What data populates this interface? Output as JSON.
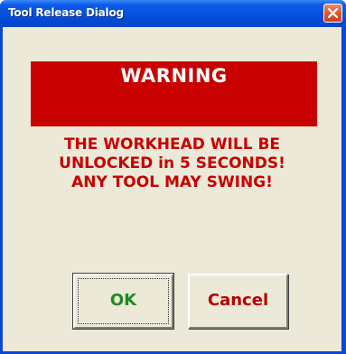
{
  "window": {
    "title": "Tool Release Dialog"
  },
  "banner": {
    "text": "WARNING",
    "color": "#c80000"
  },
  "message": {
    "lines": [
      "THE WORKHEAD WILL BE",
      "UNLOCKED in 5 SECONDS!",
      "ANY TOOL MAY SWING!"
    ],
    "color": "#c80000"
  },
  "buttons": {
    "ok_label": "OK",
    "ok_color": "#1f8a1f",
    "cancel_label": "Cancel",
    "cancel_color": "#b50000"
  },
  "icons": {
    "close": "close-icon"
  }
}
